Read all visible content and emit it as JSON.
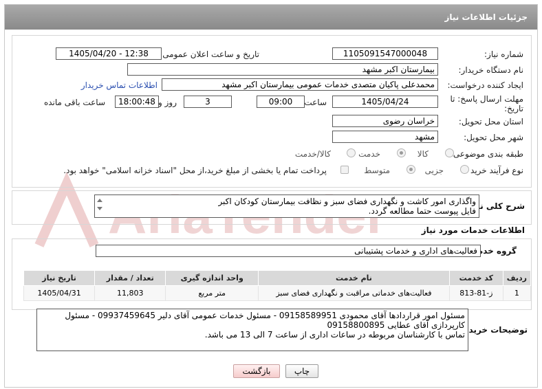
{
  "header": {
    "title": "جزئیات اطلاعات نیاز"
  },
  "fields": {
    "need_number_label": "شماره نیاز:",
    "need_number": "1105091547000048",
    "announce_label": "تاریخ و ساعت اعلان عمومی:",
    "announce_value": "1405/04/20 - 12:38",
    "buyer_org_label": "نام دستگاه خریدار:",
    "buyer_org": "بیمارستان اکبر مشهد",
    "creator_label": "ایجاد کننده درخواست:",
    "creator": "محمدعلی پاکیان متصدی خدمات عمومی بیمارستان اکبر مشهد",
    "contact_link": "اطلاعات تماس خریدار",
    "deadline_label": "مهلت ارسال پاسخ: تا تاریخ:",
    "deadline_date": "1405/04/24",
    "time_label": "ساعت",
    "deadline_time": "09:00",
    "days_value": "3",
    "days_label": "روز و",
    "remaining_time": "18:00:48",
    "remaining_label": "ساعت باقی مانده",
    "province_label": "استان محل تحویل:",
    "province": "خراسان رضوی",
    "city_label": "شهر محل تحویل:",
    "city": "مشهد",
    "category_label": "طبقه بندی موضوعی:",
    "category_options": [
      "کالا",
      "خدمت",
      "کالا/خدمت"
    ],
    "category_selected": "خدمت",
    "process_label": "نوع فرآیند خرید :",
    "process_options": [
      "جزیی",
      "متوسط"
    ],
    "process_selected": "متوسط",
    "payment_note": "پرداخت تمام یا بخشی از مبلغ خرید،از محل \"اسناد خزانه اسلامی\" خواهد بود."
  },
  "summary": {
    "label": "شرح کلی نیاز:",
    "text": "واگذاری امور کاشت و نگهداری فضای سبز و نظافت بیمارستان کودکان اکبر\nفایل پیوست حتما مطالعه گردد."
  },
  "services": {
    "section_title": "اطلاعات خدمات مورد نیاز",
    "group_label": "گروه خدمت:",
    "group_value": "فعالیت‌های اداری و خدمات پشتیبانی",
    "columns": [
      "ردیف",
      "کد خدمت",
      "نام خدمت",
      "واحد اندازه گیری",
      "تعداد / مقدار",
      "تاریخ نیاز"
    ],
    "rows": [
      [
        "1",
        "ز-81-813",
        "فعالیت‌های خدماتی مراقبت و نگهداری فضای سبز",
        "متر مربع",
        "11,803",
        "1405/04/31"
      ]
    ]
  },
  "buyer_notes": {
    "label": "توضیحات خریدار:",
    "text": "مسئول امور قراردادها آقای محمودی 09158589951 - مسئول خدمات عمومی آقای دلیر 09937459645 - مسئول کارپردازی آقای عطایی 09158800895\nتماس با کارشناسان مربوطه در ساعات اداری از ساعت 7 الی 13 می باشد."
  },
  "buttons": {
    "print": "چاپ",
    "back": "بازگشت"
  },
  "watermark": {
    "text": "AriaTender.net"
  },
  "colors": {
    "header_bg": "#959595",
    "link": "#2b4fb0",
    "watermark": "#e8b8b8"
  }
}
